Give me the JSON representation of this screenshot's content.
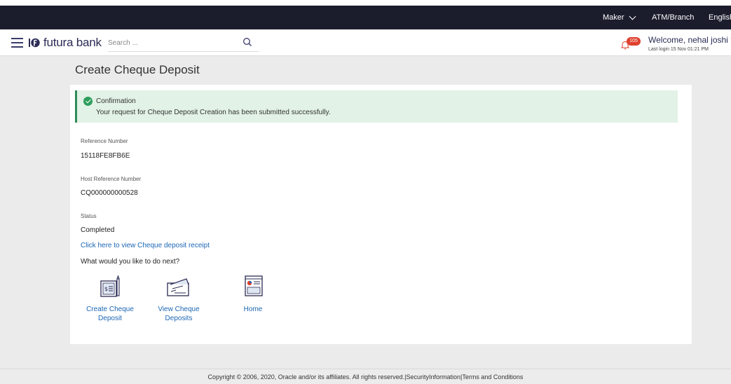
{
  "topbar": {
    "role": "Maker",
    "atm_branch": "ATM/Branch",
    "language": "English"
  },
  "header": {
    "logo_text": "futura bank",
    "search_placeholder": "Search ...",
    "notification_count": "105",
    "welcome": "Welcome, nehal joshi",
    "last_login": "Last login 15 Nov 01:21 PM"
  },
  "page": {
    "title": "Create Cheque Deposit"
  },
  "confirmation": {
    "title": "Confirmation",
    "message": "Your request for Cheque Deposit Creation has been submitted successfully."
  },
  "details": {
    "reference_label": "Reference Number",
    "reference_value": "15118FE8FB6E",
    "host_reference_label": "Host Reference Number",
    "host_reference_value": "CQ000000000528",
    "status_label": "Status",
    "status_value": "Completed"
  },
  "receipt_link": "Click here to view Cheque deposit receipt",
  "next_prompt": "What would you like to do next?",
  "actions": [
    {
      "label_line1": "Create Cheque",
      "label_line2": "Deposit",
      "icon": "cheque-create-icon"
    },
    {
      "label_line1": "View Cheque",
      "label_line2": "Deposits",
      "icon": "cheque-view-icon"
    },
    {
      "label_line1": "Home",
      "label_line2": "",
      "icon": "home-dashboard-icon"
    }
  ],
  "footer": {
    "copyright": "Copyright © 2006, 2020, Oracle and/or its affiliates. All rights reserved.",
    "security_link": "SecurityInformation",
    "terms_link": "Terms and Conditions"
  },
  "colors": {
    "topbar_bg": "#1b1c2c",
    "link": "#1b66b5",
    "success_bg": "#e2f2e6",
    "success_accent": "#2e8b57",
    "badge": "#e0412e"
  }
}
